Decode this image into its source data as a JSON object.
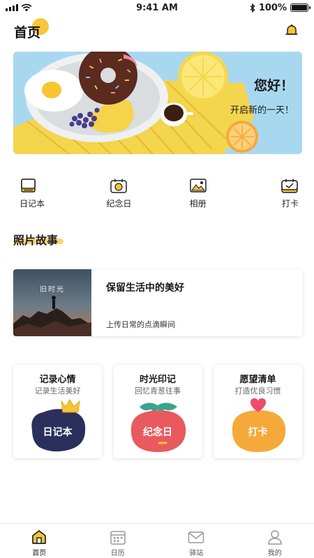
{
  "status_bar": {
    "time": "9:41 AM",
    "battery_text": "100%",
    "battery_level": 1.0
  },
  "header": {
    "title": "首页",
    "accent_color": "#f7c531"
  },
  "banner": {
    "greeting": "您好！",
    "subtitle": "开启新的一天！"
  },
  "quick_entries": [
    {
      "label": "日记本",
      "icon": "diary-book-icon"
    },
    {
      "label": "纪念日",
      "icon": "anniversary-calendar-icon"
    },
    {
      "label": "相册",
      "icon": "photo-album-icon"
    },
    {
      "label": "打卡",
      "icon": "check-in-calendar-icon"
    }
  ],
  "section": {
    "title": "照片故事"
  },
  "story": {
    "photo_text": "旧时光",
    "title": "保留生活中的美好",
    "description": "上传日常的点滴瞬间"
  },
  "features": [
    {
      "title": "记录心情",
      "subtitle": "记录生活美好",
      "art_label": "日记本",
      "color": "#2a2f5c"
    },
    {
      "title": "时光印记",
      "subtitle": "回忆青葱往事",
      "art_label": "纪念日",
      "color": "#e85a5e"
    },
    {
      "title": "愿望清单",
      "subtitle": "打造优良习惯",
      "art_label": "打卡",
      "color": "#f6a93b"
    }
  ],
  "tab_bar": {
    "items": [
      {
        "label": "首页",
        "icon": "home-icon",
        "active": true
      },
      {
        "label": "日历",
        "icon": "calendar-icon",
        "active": false
      },
      {
        "label": "驿站",
        "icon": "mail-icon",
        "active": false
      },
      {
        "label": "我的",
        "icon": "user-icon",
        "active": false
      }
    ]
  }
}
